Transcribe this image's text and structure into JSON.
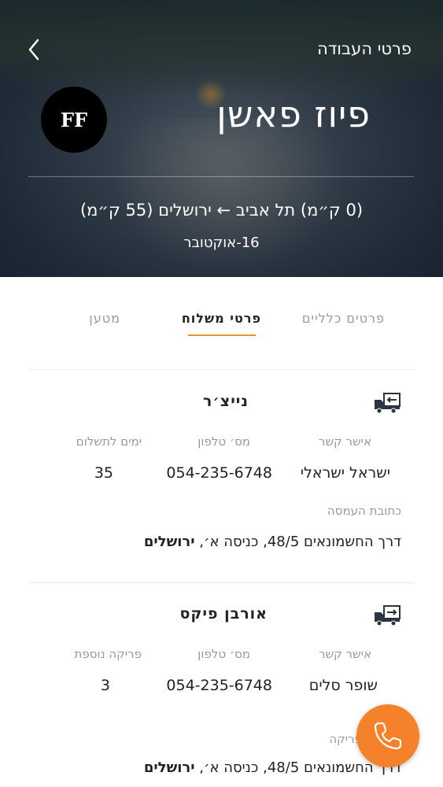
{
  "header": {
    "title": "פרטי העבודה",
    "avatar_initials": "FF",
    "company_name": "פיוז פאשן",
    "route": "(0 ק״מ) תל אביב ← ירושלים (55 ק״מ)",
    "date": "16-אוקטובר"
  },
  "tabs": [
    {
      "label": "פרטים כלליים",
      "active": false
    },
    {
      "label": "פרטי משלוח",
      "active": true
    },
    {
      "label": "מטען",
      "active": false
    }
  ],
  "pickup": {
    "icon": "truck-unload-icon",
    "title": "נייצ׳ר",
    "contact_label": "אישר קשר",
    "contact_value": "ישראל ישראלי",
    "phone_label": "מס׳ טלפון",
    "phone_value": "054-235-6748",
    "days_label": "ימים לתשלום",
    "days_value": "35",
    "address_label": "כתובת העמסה",
    "address_street": "דרך החשמונאים 48/5, כניסה א׳,",
    "address_city": "ירושלים"
  },
  "dropoff": {
    "icon": "truck-load-icon",
    "title": "אורבן פיקס",
    "contact_label": "אישר קשר",
    "contact_value": "שופר סלים",
    "phone_label": "מס׳ טלפון",
    "phone_value": "054-235-6748",
    "extra_label": "פריקה נוספת",
    "extra_value": "3",
    "address_label": "פריקה",
    "address_street": "דרך החשמונאים 48/5, כניסה א׳,",
    "address_city": "ירושלים"
  },
  "colors": {
    "accent": "#e8922f",
    "call_button": "#f5822a",
    "header_bg": "#26323f"
  },
  "icons": {
    "back": "chevron-left-icon",
    "call": "phone-icon"
  }
}
